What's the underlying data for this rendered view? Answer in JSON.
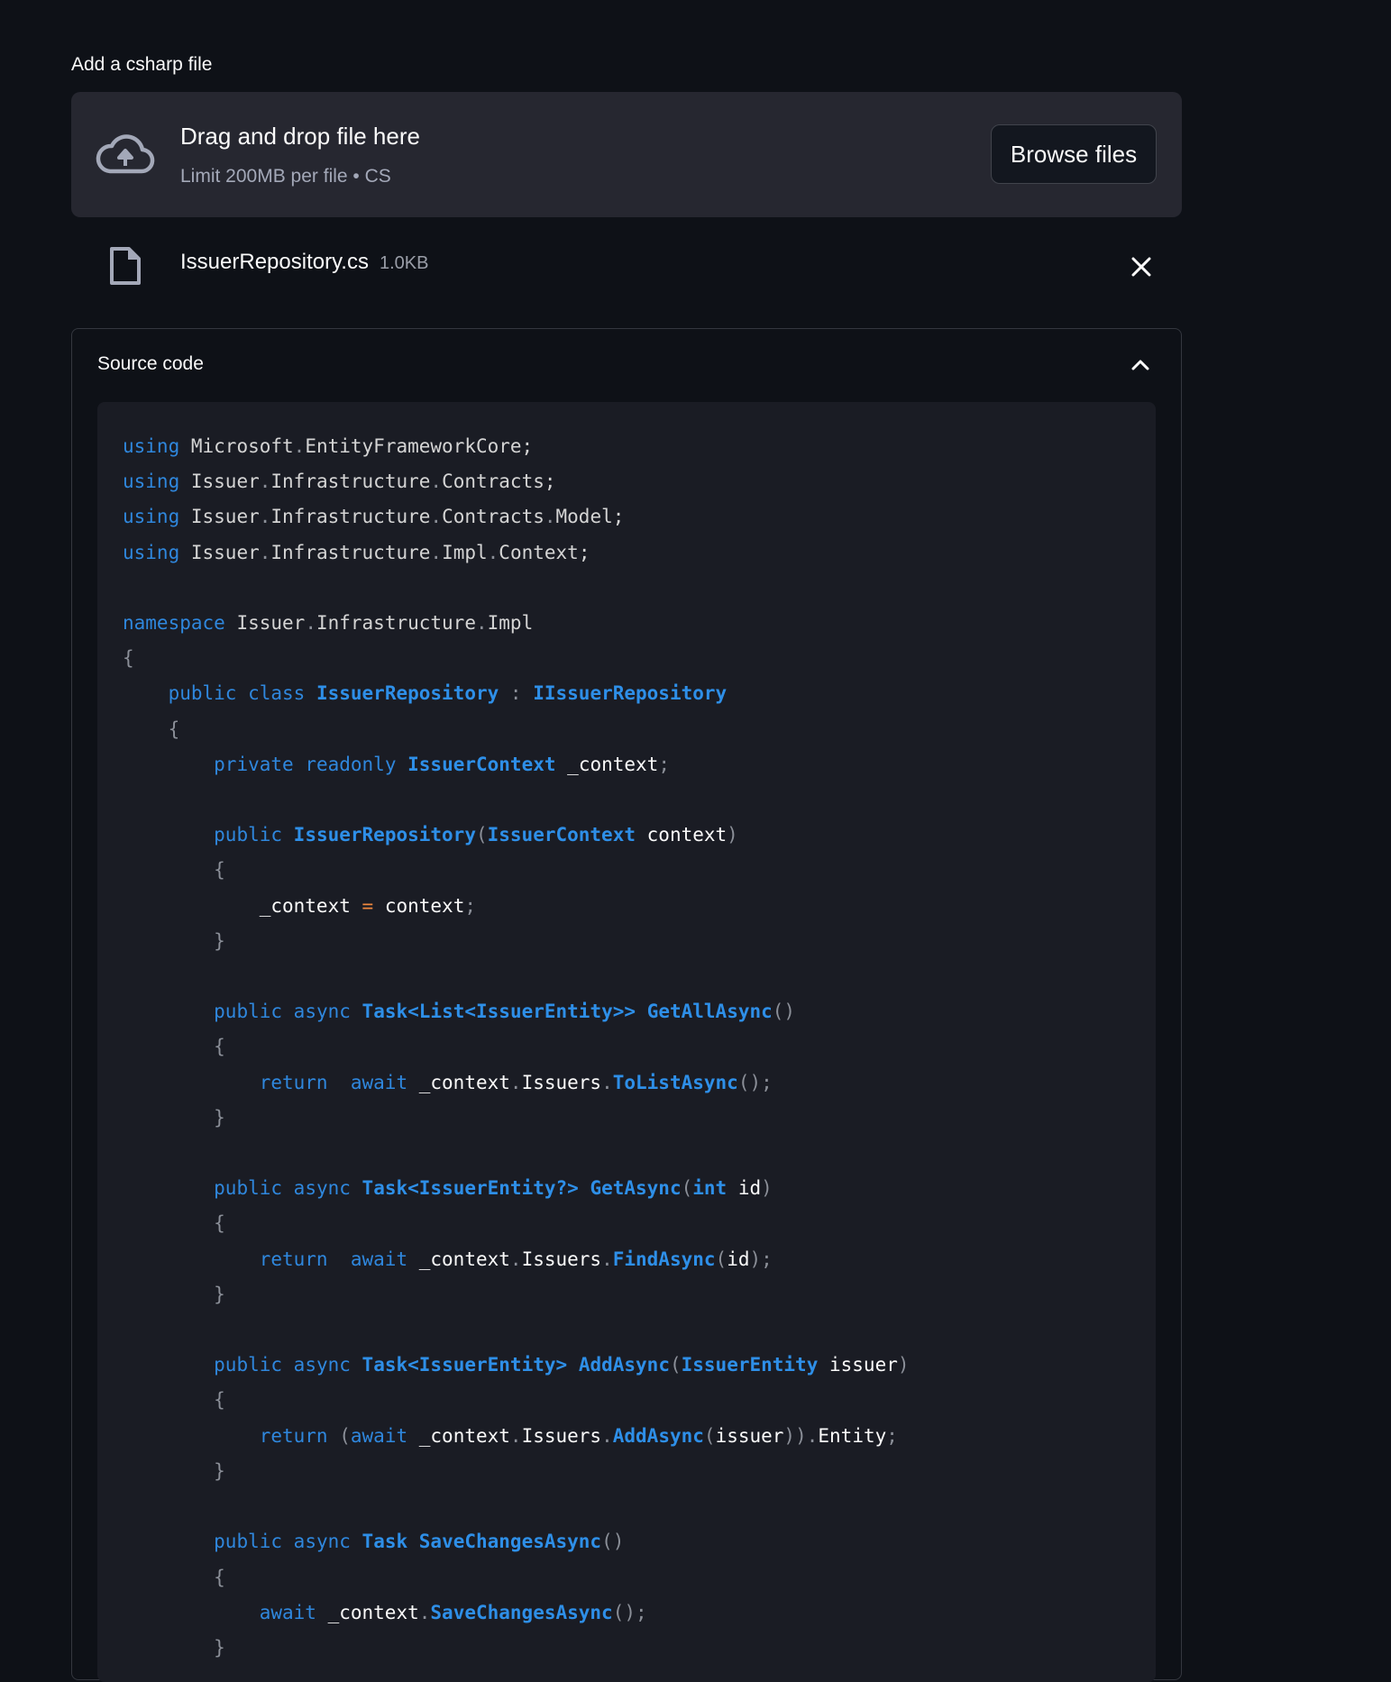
{
  "uploader": {
    "label": "Add a csharp file",
    "dropzone_title": "Drag and drop file here",
    "dropzone_subtitle": "Limit 200MB per file • CS",
    "browse_label": "Browse files",
    "icon": "cloud-upload-icon"
  },
  "uploaded_file": {
    "name": "IssuerRepository.cs",
    "size": "1.0KB",
    "icon": "file-icon",
    "remove_icon": "close-icon"
  },
  "expander": {
    "title": "Source code",
    "state": "expanded",
    "icon": "chevron-up-icon"
  },
  "code": {
    "language": "csharp",
    "lines": [
      "using Microsoft.EntityFrameworkCore;",
      "using Issuer.Infrastructure.Contracts;",
      "using Issuer.Infrastructure.Contracts.Model;",
      "using Issuer.Infrastructure.Impl.Context;",
      "",
      "namespace Issuer.Infrastructure.Impl",
      "{",
      "    public class IssuerRepository : IIssuerRepository",
      "    {",
      "        private readonly IssuerContext _context;",
      "",
      "        public IssuerRepository(IssuerContext context)",
      "        {",
      "            _context = context;",
      "        }",
      "",
      "        public async Task<List<IssuerEntity>> GetAllAsync()",
      "        {",
      "            return  await _context.Issuers.ToListAsync();",
      "        }",
      "",
      "        public async Task<IssuerEntity?> GetAsync(int id)",
      "        {",
      "            return  await _context.Issuers.FindAsync(id);",
      "        }",
      "",
      "        public async Task<IssuerEntity> AddAsync(IssuerEntity issuer)",
      "        {",
      "            return (await _context.Issuers.AddAsync(issuer)).Entity;",
      "        }",
      "",
      "        public async Task SaveChangesAsync()",
      "        {",
      "            await _context.SaveChangesAsync();",
      "        }"
    ]
  },
  "colors": {
    "background": "#0e1117",
    "dropzone": "#262730",
    "code_background": "#1a1c24",
    "keyword": "#2f87dd",
    "type": "#2e8fe8",
    "operator": "#f0883e"
  }
}
